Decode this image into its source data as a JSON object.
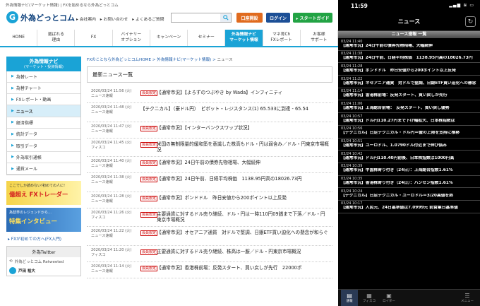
{
  "site": {
    "topbar": "外為情報ナビ(マーケット情報) | FXを始めるなら外為どっとコム",
    "logo": {
      "mark": "G",
      "text": "外為どっとコム"
    },
    "util_links": [
      "▸ 会社案内",
      "▸ お問い合わせ",
      "▸ よくあるご質問"
    ],
    "header_buttons": {
      "open": "口座開設",
      "login": "ログイン",
      "guide": "▸ スタートガイド"
    },
    "gnav": [
      {
        "label": "HOME"
      },
      {
        "label": "選ばれる\n理由"
      },
      {
        "label": "FX"
      },
      {
        "label": "バイナリー\nオプション"
      },
      {
        "label": "キャンペーン"
      },
      {
        "label": "セミナー"
      },
      {
        "label": "外為情報ナビ\nマーケット情報"
      },
      {
        "label": "マネ育Ch\nFXレポート"
      },
      {
        "label": "お客様\nサポート"
      }
    ],
    "sidebar": {
      "title": "外為情報ナビ",
      "subtitle": "(マーケット・投資情報)",
      "items": [
        "為替レート",
        "為替チャート",
        "FXレポート・動画",
        "ニュース",
        "経済指標",
        "統計データ",
        "取引データ",
        "外為取引通帳",
        "通貨メール"
      ],
      "banner1_small": "ここでしか読めない!初めての人に!",
      "banner1_big": "億超え FXトレーダー",
      "banner2_small": "為替界のレジェンドから…",
      "banner2_big": "特集インタビュー",
      "fx_link": "▸ FXが初めての方へ(FX入門)",
      "twitter_head": "外為Twitter",
      "twitter_retweeted": "外為どっとコム Retweeted",
      "twitter_user": "戸田 裕大"
    },
    "breadcrumb": "FXのことなら外為どっとコムHOME > 外為情報ナビ(マーケット情報) > ",
    "breadcrumb_current": "ニュース",
    "section_title": "最新ニュース一覧",
    "badge_label": "会員限定",
    "news": [
      {
        "time": "2020/03/24 11:56 (火)",
        "source": "ニュース速報",
        "badge": true,
        "text": "【通常市況】【よろずのつぶやき by Wada】インフィニティ"
      },
      {
        "time": "2020/03/24 11:48 (火)",
        "source": "ニュース速報",
        "badge": false,
        "text": "【テクニカル】（豪ドル円）　ピボット・レジスタンス(1) 65.533に到達 - 65.54"
      },
      {
        "time": "2020/03/24 11:47 (火)",
        "source": "ニュース速報",
        "badge": true,
        "text": "【通常市況】【インターバンクスワップ状況】"
      },
      {
        "time": "2020/03/24 11:45 (火)",
        "source": "フィスコ",
        "badge": true,
        "text": "米国の無制限量的緩和策を意識した株高もドル・円は弱含み／ドル・円東京市場概況"
      },
      {
        "time": "2020/03/24 11:40 (火)",
        "source": "ニュース速報",
        "badge": true,
        "text": "【通常市況】24日午前の債券先物相場、大幅続伸"
      },
      {
        "time": "2020/03/24 11:38 (火)",
        "source": "ニュース速報",
        "badge": true,
        "text": "【通常市況】24日午前、日経平均株価　1138.95円高の18026.73円"
      },
      {
        "time": "2020/03/24 11:28 (火)",
        "source": "ニュース速報",
        "badge": true,
        "text": "【通常市況】ポンドドル　昨日安値から200ポイント以上反発"
      },
      {
        "time": "2020/03/24 11:26 (火)",
        "source": "フィスコ",
        "badge": true,
        "text": "主要通貨に対するドル売り継続、ドル・円は一時110円09銭まで下落／ドル・円東京市場概況"
      },
      {
        "time": "2020/03/24 11:22 (火)",
        "source": "ニュース速報",
        "badge": true,
        "text": "【通常市況】オセアニア通貨　対ドルで堅調、日銀ETF買い迫化への懸念が和らぐ"
      },
      {
        "time": "2020/03/24 11:20 (火)",
        "source": "フィスコ",
        "badge": true,
        "text": "主要通貨に対するドル売り継続、株高は一服／ドル・円東京市場概況"
      },
      {
        "time": "2020/03/24 11:14 (火)",
        "source": "ニュース速報",
        "badge": true,
        "text": "【通常市況】香港株前場：反発スタート、買い戻しが先行　22000ポ"
      }
    ]
  },
  "phone": {
    "time": "11:59",
    "status_icons": "▂▄▆ ≋ ▭",
    "title": "ニュース",
    "refresh_icon": "↻",
    "list_head": "ニュース速報 一覧",
    "news": [
      {
        "time": "03/24 11:40",
        "text": "【通常市況】24日午前の債券先物相場、大幅続伸"
      },
      {
        "time": "03/24 11:38",
        "text": "【通常市況】24日午前、日経平均株価　1138.95円高の18026.73円"
      },
      {
        "time": "03/24 11:28",
        "text": "【通常市況】ポンドドル　昨日安値から200ポイント以上反発"
      },
      {
        "time": "03/24 11:22",
        "text": "【通常市況】オセアニア通貨　対ドルで堅調、日銀ETF買い迫化への懸念"
      },
      {
        "time": "03/24 11:14",
        "text": "【通常市況】香港株前場：反発スタート、買い戻しが先行"
      },
      {
        "time": "03/24 11:06",
        "text": "【通常市況】上海総合前場：　反発スタート、買い戻し優勢"
      },
      {
        "time": "03/24 10:57",
        "text": "【通常市況】ドル円110.27円まで下げ幅拡大、日本株指数は"
      },
      {
        "time": "03/24 10:56",
        "text": "【テクニカル】日足テクニカル・ドル円＝雲の上限を支持に推移"
      },
      {
        "time": "03/24 10:51",
        "text": "【通常市況】ユーロドル、1.0790ドル付近まで伸び悩み"
      },
      {
        "time": "03/24 10:42",
        "text": "【通常市況】ドル円110.40円前後、日本株指数は1000円高"
      },
      {
        "time": "03/24 10:39",
        "text": "【通常市況】中国株寄り付き（24日）：上海総合指数1.61%"
      },
      {
        "time": "03/24 10:35",
        "text": "【通常市況】香港株寄り付き（24日）：ハンセン指数1.61%"
      },
      {
        "time": "03/24 10:24",
        "text": "【テクニカル】日足テクニカル・ユーロドル＝3/20高値を終"
      },
      {
        "time": "03/24 10:17",
        "text": "【通常市況】人民元、24日基準値は7.0999元 前営業日基準値"
      }
    ],
    "tabs": [
      {
        "icon": "▤",
        "label": "速報"
      },
      {
        "icon": "▦",
        "label": "フィスコ"
      },
      {
        "icon": "▣",
        "label": "ロイター"
      }
    ],
    "menu_tab": {
      "icon": "☰",
      "label": "メニュー"
    }
  }
}
